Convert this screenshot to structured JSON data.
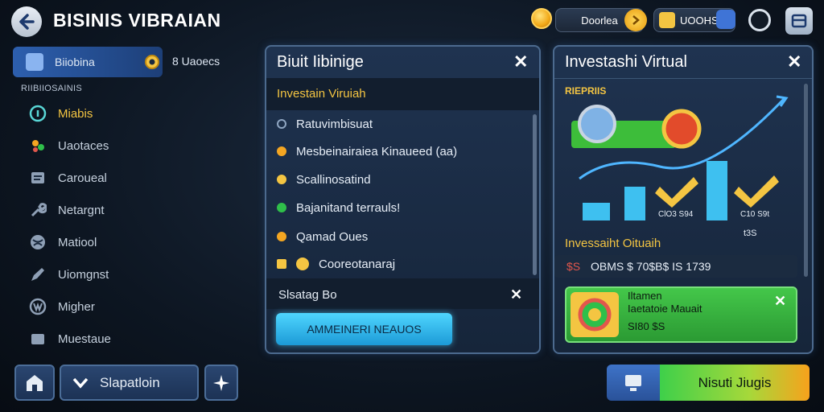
{
  "header": {
    "title": "BISINIS VIBRAIAN",
    "currency1_label": "Doorlea",
    "currency2_label": "UOOHS"
  },
  "sidebar": {
    "active_item": "Biiobina",
    "counter": "8 Uaoecs",
    "section_title": "RIIBIIOSAINIS",
    "items": [
      {
        "label": "Miabis",
        "color": "#f4c542",
        "icon": "chart-icon"
      },
      {
        "label": "Uaotaces",
        "color": "#c6d1de",
        "icon": "people-icon"
      },
      {
        "label": "Caroueal",
        "color": "#c6d1de",
        "icon": "document-icon"
      },
      {
        "label": "Netargnt",
        "color": "#c6d1de",
        "icon": "wrench-icon"
      },
      {
        "label": "Matiool",
        "color": "#c6d1de",
        "icon": "globe-icon"
      },
      {
        "label": "Uiomgnst",
        "color": "#c6d1de",
        "icon": "pen-icon"
      },
      {
        "label": "Migher",
        "color": "#c6d1de",
        "icon": "web-icon"
      },
      {
        "label": "Muestaue",
        "color": "#c6d1de",
        "icon": "folder-icon"
      }
    ]
  },
  "middle_panel": {
    "title": "Biuit Iibinige",
    "subtitle": "Investain Viruiah",
    "rows": [
      {
        "label": "Ratuvimbisuat",
        "dot": "#8fa6c2"
      },
      {
        "label": "Mesbeinairaiea Kinaueed (aa)",
        "dot": "#f4a622"
      },
      {
        "label": "Scallinosatind",
        "dot": "#f4c542"
      },
      {
        "label": "Bajanitand terrauls!",
        "dot": "#2fbf4a"
      },
      {
        "label": "Qamad Oues",
        "dot": "#f4a622"
      },
      {
        "label": "Cooreotanaraj",
        "dot": "#f4c542"
      }
    ],
    "footer_label": "Slsatag Bo",
    "action_button": "AMMEINERI NEAUOS"
  },
  "right_panel": {
    "title": "Investashi Virtual",
    "chart_caption": "RIEPRIIS",
    "bar_label_1": "ClO3 S94",
    "bar_label_2": "C10 S9t",
    "bar_label_3": "t3S",
    "section_title": "Invessaiht Oituaih",
    "stat_prefix": "$S",
    "stat_line": "OBMS $ 70$B$ IS 1739",
    "card_title": "Iltamen",
    "card_line": "Iaetatoie Mauait",
    "card_price": "SI80 $S"
  },
  "bottom": {
    "dropdown_label": "Slapatloin",
    "cta_label": "Nisuti Jiugis"
  },
  "colors": {
    "accent_blue": "#2d6fd6",
    "accent_green": "#35c24a",
    "accent_yellow": "#f4c542",
    "cyan_button": "#2bb8ec"
  }
}
